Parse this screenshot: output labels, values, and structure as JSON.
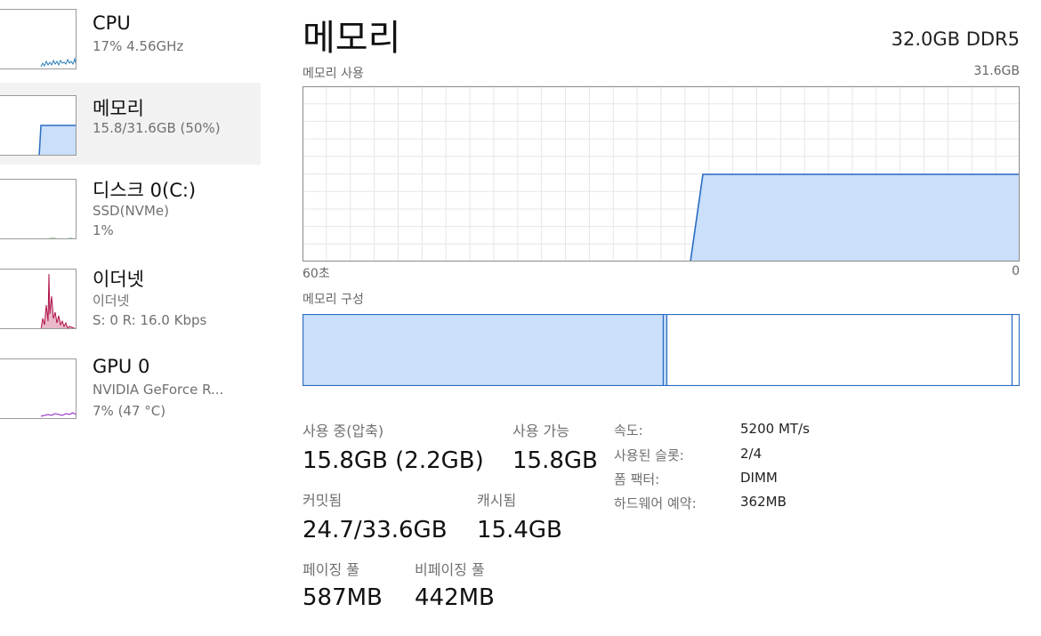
{
  "sidebar": {
    "items": [
      {
        "title": "CPU",
        "lines": [
          "17% 4.56GHz"
        ]
      },
      {
        "title": "메모리",
        "lines": [
          "15.8/31.6GB (50%)"
        ]
      },
      {
        "title": "디스크 0(C:)",
        "lines": [
          "SSD(NVMe)",
          "1%"
        ]
      },
      {
        "title": "이더넷",
        "lines": [
          "이더넷",
          "S: 0 R: 16.0 Kbps"
        ]
      },
      {
        "title": "GPU 0",
        "lines": [
          "NVIDIA GeForce R...",
          "7% (47 °C)"
        ]
      }
    ]
  },
  "main": {
    "title": "메모리",
    "spec": "32.0GB DDR5",
    "usage_label": "메모리 사용",
    "usage_max": "31.6GB",
    "axis_left": "60초",
    "axis_right": "0",
    "composition_label": "메모리 구성",
    "stats": {
      "in_use_label": "사용 중(압축)",
      "in_use_value": "15.8GB (2.2GB)",
      "available_label": "사용 가능",
      "available_value": "15.8GB",
      "committed_label": "커밋됨",
      "committed_value": "24.7/33.6GB",
      "cached_label": "캐시됨",
      "cached_value": "15.4GB",
      "paged_label": "페이징 풀",
      "paged_value": "587MB",
      "nonpaged_label": "비페이징 풀",
      "nonpaged_value": "442MB"
    },
    "details": [
      {
        "key": "속도:",
        "value": "5200 MT/s"
      },
      {
        "key": "사용된 슬롯:",
        "value": "2/4"
      },
      {
        "key": "폼 팩터:",
        "value": "DIMM"
      },
      {
        "key": "하드웨어 예약:",
        "value": "362MB"
      }
    ]
  },
  "colors": {
    "memory_line": "#2a6cc4",
    "memory_fill": "#c9dffa",
    "grid": "#e6e6e6",
    "ethernet": "#b0104a",
    "gpu": "#8a1fc0",
    "cpu": "#2a7fb8",
    "disk": "#3a9a3a"
  }
}
